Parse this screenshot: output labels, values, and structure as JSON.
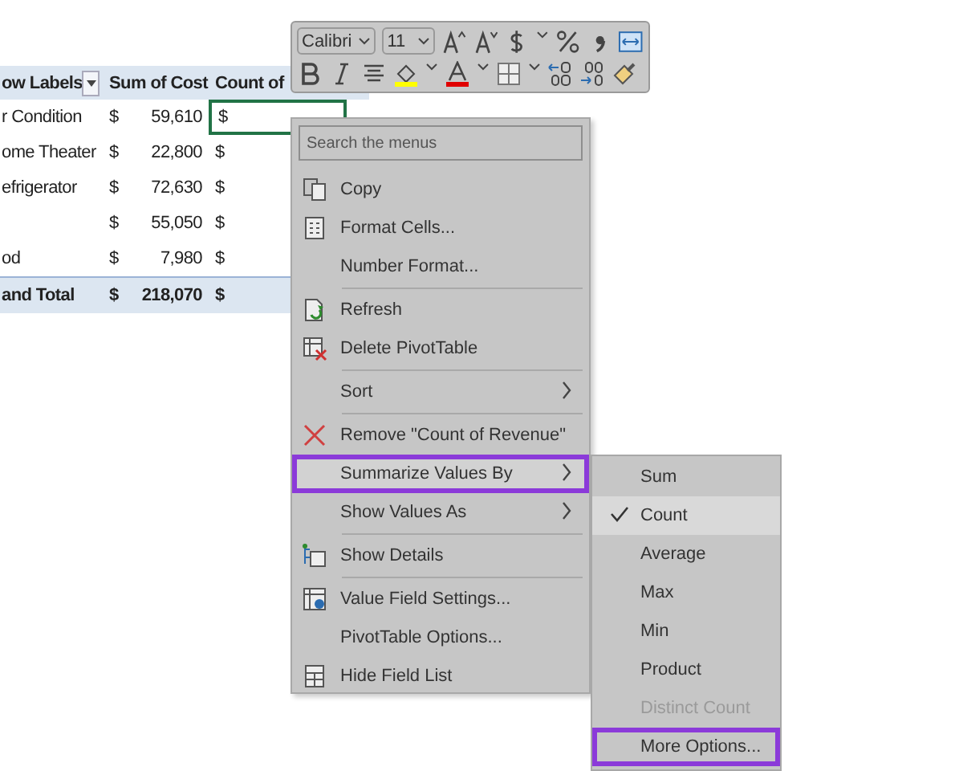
{
  "sheet": {
    "columns": [
      "ow Labels",
      "Sum of Cost",
      "Count of"
    ],
    "rows": [
      {
        "label": "r Condition",
        "cost_currency": "$",
        "cost": "59,610",
        "count_currency": "$",
        "selected": true
      },
      {
        "label": "ome Theater",
        "cost_currency": "$",
        "cost": "22,800",
        "count_currency": "$",
        "selected": false
      },
      {
        "label": "efrigerator",
        "cost_currency": "$",
        "cost": "72,630",
        "count_currency": "$",
        "selected": false
      },
      {
        "cost_currency": "$",
        "cost": "55,050",
        "count_currency": "$",
        "selected": false
      },
      {
        "label": "od",
        "cost_currency": "$",
        "cost": "7,980",
        "count_currency": "$",
        "selected": false
      }
    ],
    "total": {
      "label": "and Total",
      "cost_currency": "$",
      "cost": "218,070",
      "count_currency": "$"
    }
  },
  "mini_toolbar": {
    "font": "Calibri",
    "size": "11"
  },
  "context_menu": {
    "search_placeholder": "Search the menus",
    "items": [
      {
        "label": "Copy",
        "separator_before": false,
        "submenu": false,
        "highlighted": false
      },
      {
        "label": "Format Cells...",
        "separator_before": false,
        "submenu": false,
        "highlighted": false
      },
      {
        "label": "Number Format...",
        "separator_before": false,
        "submenu": false,
        "highlighted": false
      },
      {
        "label": "Refresh",
        "separator_before": true,
        "submenu": false,
        "highlighted": false
      },
      {
        "label": "Delete PivotTable",
        "separator_before": false,
        "submenu": false,
        "highlighted": false
      },
      {
        "label": "Sort",
        "separator_before": true,
        "submenu": true,
        "highlighted": false
      },
      {
        "label": "Remove \"Count of Revenue\"",
        "separator_before": true,
        "submenu": false,
        "highlighted": false
      },
      {
        "label": "Summarize Values By",
        "separator_before": false,
        "submenu": true,
        "highlighted": true
      },
      {
        "label": "Show Values As",
        "separator_before": false,
        "submenu": true,
        "highlighted": false
      },
      {
        "label": "Show Details",
        "separator_before": true,
        "submenu": false,
        "highlighted": false
      },
      {
        "label": "Value Field Settings...",
        "separator_before": true,
        "submenu": false,
        "highlighted": false
      },
      {
        "label": "PivotTable Options...",
        "separator_before": false,
        "submenu": false,
        "highlighted": false
      },
      {
        "label": "Hide Field List",
        "separator_before": false,
        "submenu": false,
        "highlighted": false
      }
    ]
  },
  "submenu": {
    "items": [
      {
        "label": "Sum",
        "selected": false,
        "disabled": false,
        "highlighted": false
      },
      {
        "label": "Count",
        "selected": true,
        "disabled": false,
        "highlighted": false
      },
      {
        "label": "Average",
        "selected": false,
        "disabled": false,
        "highlighted": false
      },
      {
        "label": "Max",
        "selected": false,
        "disabled": false,
        "highlighted": false
      },
      {
        "label": "Min",
        "selected": false,
        "disabled": false,
        "highlighted": false
      },
      {
        "label": "Product",
        "selected": false,
        "disabled": false,
        "highlighted": false
      },
      {
        "label": "Distinct Count",
        "selected": false,
        "disabled": true,
        "highlighted": false
      },
      {
        "label": "More Options...",
        "selected": false,
        "disabled": false,
        "highlighted": true
      }
    ]
  }
}
